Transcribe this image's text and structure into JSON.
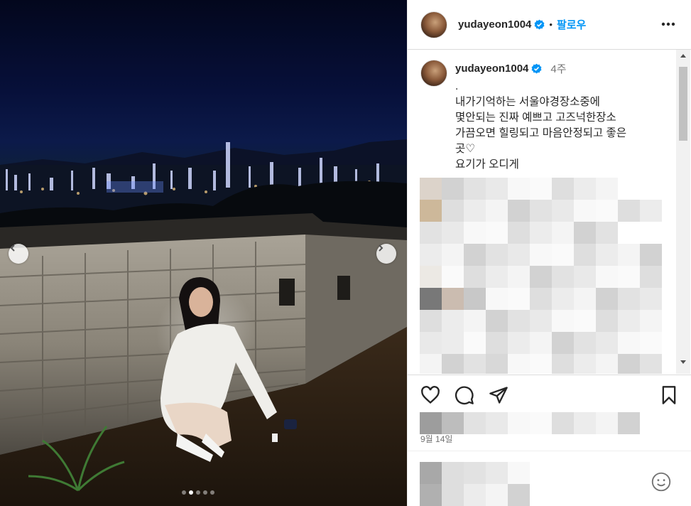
{
  "post": {
    "username": "yudayeon1004",
    "follow_label": "팔로우",
    "separator": "•"
  },
  "caption": {
    "username": "yudayeon1004",
    "time": "4주",
    "text": ".\n내가기억하는 서울야경장소중에\n몇안되는 진짜 예쁘고 고즈넉한장소\n가끔오면 힐링되고 마음안정되고 좋은\n곳♡\n요기가 오디게"
  },
  "date_label": "9월 14일",
  "carousel": {
    "total": 5,
    "active": 2
  },
  "icons": {
    "verified": "verified-badge-icon",
    "more": "more-options-icon",
    "like": "heart-icon",
    "comment": "comment-bubble-icon",
    "share": "paper-plane-icon",
    "save": "bookmark-icon",
    "emoji": "emoji-smile-icon",
    "prev": "chevron-left-icon",
    "next": "chevron-right-icon"
  },
  "colors": {
    "accent": "#0095f6",
    "verified": "#0095f6",
    "text": "#262626",
    "muted": "#737373"
  }
}
